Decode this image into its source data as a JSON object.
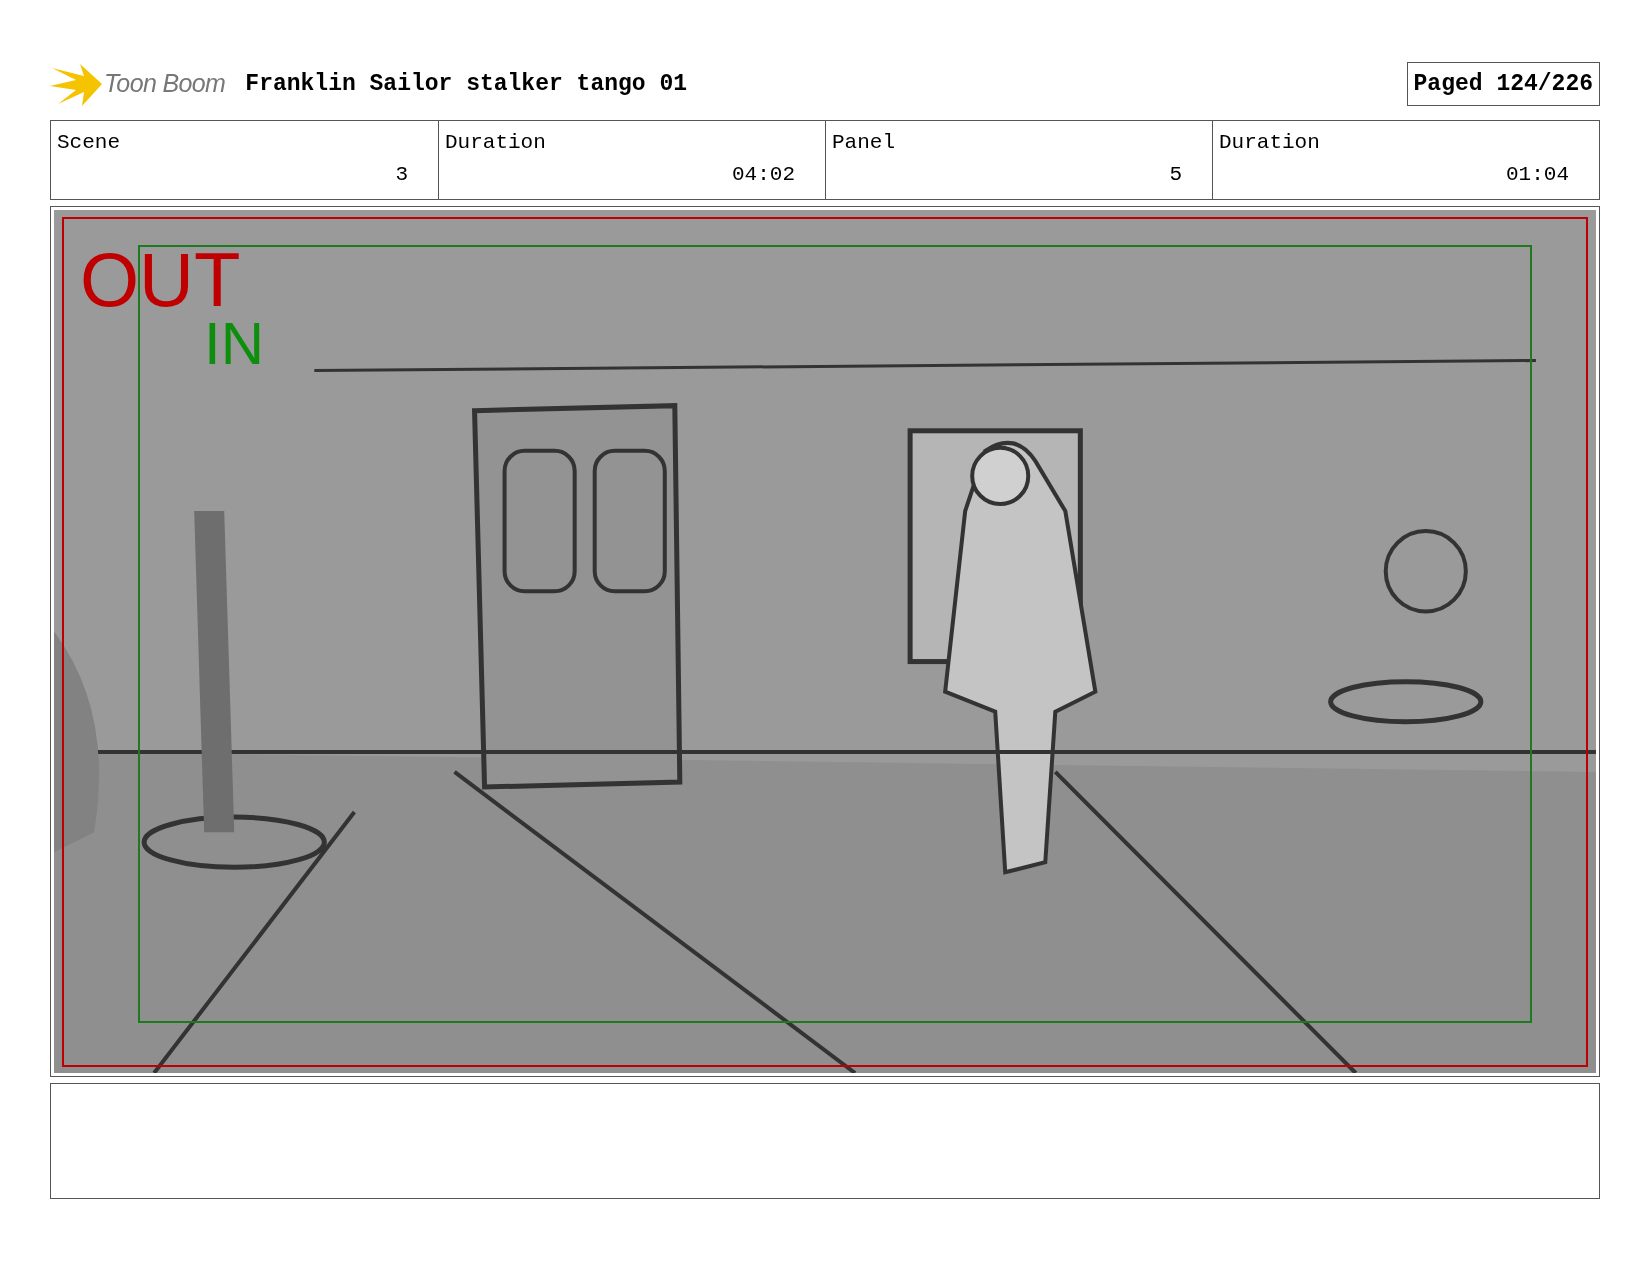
{
  "header": {
    "logo_text": "Toon Boom",
    "title": "Franklin Sailor stalker tango 01",
    "page": "Paged 124/226"
  },
  "info_table": [
    {
      "label": "Scene",
      "value": "3"
    },
    {
      "label": "Duration",
      "value": "04:02"
    },
    {
      "label": "Panel",
      "value": "5"
    },
    {
      "label": "Duration",
      "value": "01:04"
    }
  ],
  "panel": {
    "out_label": "OUT",
    "in_label": "IN"
  }
}
